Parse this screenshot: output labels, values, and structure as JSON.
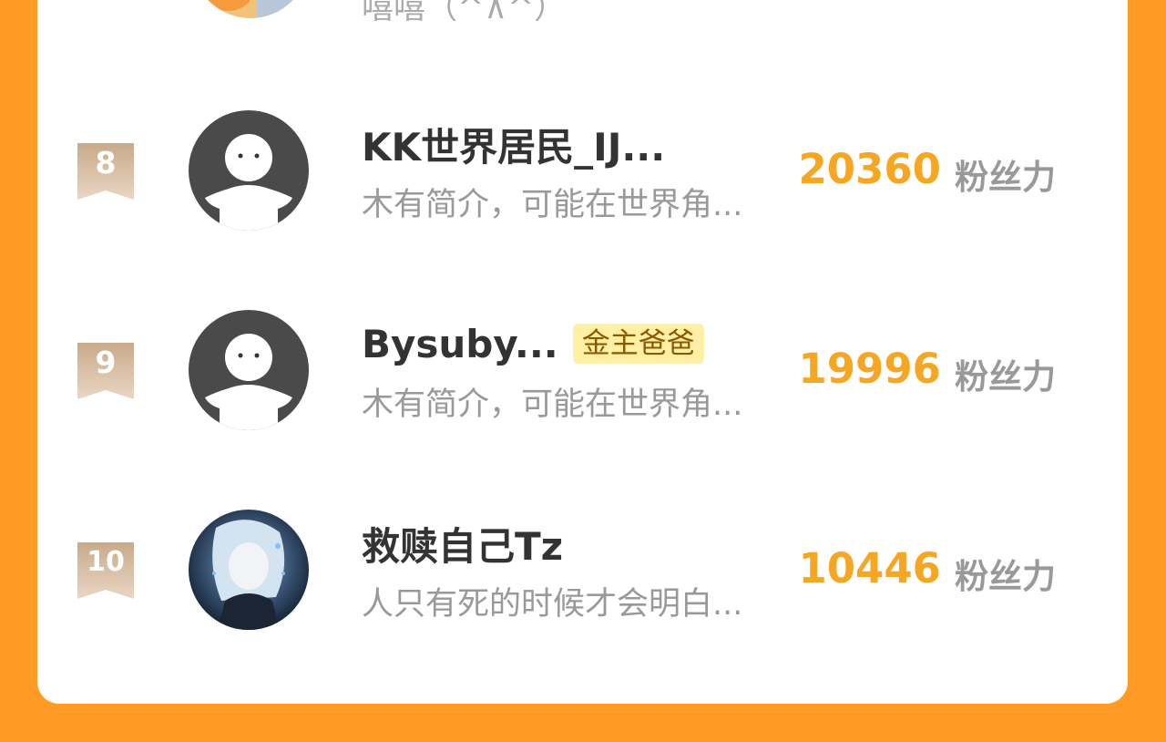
{
  "top_partial": {
    "intro": "嘻嘻（^∧^）"
  },
  "rows": [
    {
      "rank": "8",
      "name": "KK世界居民_IJ...",
      "tag": "",
      "intro": "木有简介，可能在世界角...",
      "score": "20360",
      "unit": "粉丝力",
      "avatar": "default-avatar"
    },
    {
      "rank": "9",
      "name": "Bysuby...",
      "tag": "金主爸爸",
      "intro": "木有简介，可能在世界角...",
      "score": "19996",
      "unit": "粉丝力",
      "avatar": "default-avatar"
    },
    {
      "rank": "10",
      "name": "救赎自己Tz",
      "tag": "",
      "intro": "人只有死的时候才会明白...",
      "score": "10446",
      "unit": "粉丝力",
      "avatar": "anime-avatar"
    }
  ],
  "colors": {
    "background": "#ff9a24",
    "card": "#ffffff",
    "score": "#f5a623",
    "tag_bg": "#fff0a6",
    "badge": "#d9bfa4"
  }
}
